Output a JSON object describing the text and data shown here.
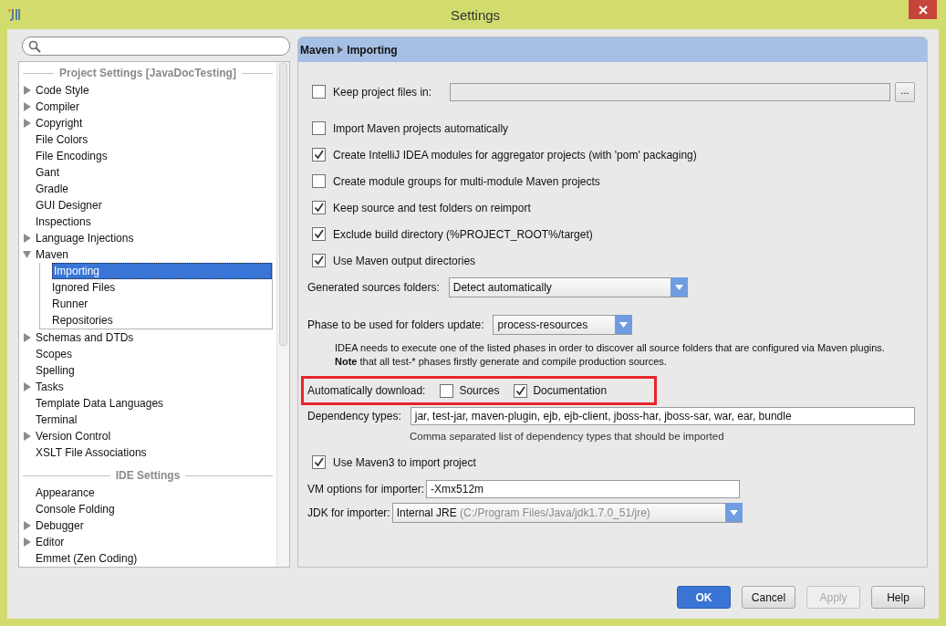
{
  "window": {
    "title": "Settings"
  },
  "sidebar": {
    "sections": [
      {
        "title": "Project Settings [JavaDocTesting]",
        "items": [
          {
            "label": "Code Style",
            "expandable": true,
            "expanded": false,
            "selected": false
          },
          {
            "label": "Compiler",
            "expandable": true,
            "expanded": false,
            "selected": false
          },
          {
            "label": "Copyright",
            "expandable": true,
            "expanded": false,
            "selected": false
          },
          {
            "label": "File Colors",
            "expandable": false,
            "selected": false
          },
          {
            "label": "File Encodings",
            "expandable": false,
            "selected": false
          },
          {
            "label": "Gant",
            "expandable": false,
            "selected": false
          },
          {
            "label": "Gradle",
            "expandable": false,
            "selected": false
          },
          {
            "label": "GUI Designer",
            "expandable": false,
            "selected": false
          },
          {
            "label": "Inspections",
            "expandable": false,
            "selected": false
          },
          {
            "label": "Language Injections",
            "expandable": true,
            "expanded": false,
            "selected": false
          },
          {
            "label": "Maven",
            "expandable": true,
            "expanded": true,
            "selected": false,
            "children": [
              {
                "label": "Importing",
                "selected": true
              },
              {
                "label": "Ignored Files",
                "selected": false
              },
              {
                "label": "Runner",
                "selected": false
              },
              {
                "label": "Repositories",
                "selected": false
              }
            ]
          },
          {
            "label": "Schemas and DTDs",
            "expandable": true,
            "expanded": false,
            "selected": false
          },
          {
            "label": "Scopes",
            "expandable": false,
            "selected": false
          },
          {
            "label": "Spelling",
            "expandable": false,
            "selected": false
          },
          {
            "label": "Tasks",
            "expandable": true,
            "expanded": false,
            "selected": false
          },
          {
            "label": "Template Data Languages",
            "expandable": false,
            "selected": false
          },
          {
            "label": "Terminal",
            "expandable": false,
            "selected": false
          },
          {
            "label": "Version Control",
            "expandable": true,
            "expanded": false,
            "selected": false
          },
          {
            "label": "XSLT File Associations",
            "expandable": false,
            "selected": false
          }
        ]
      },
      {
        "title": "IDE Settings",
        "items": [
          {
            "label": "Appearance",
            "expandable": false,
            "selected": false
          },
          {
            "label": "Console Folding",
            "expandable": false,
            "selected": false
          },
          {
            "label": "Debugger",
            "expandable": true,
            "expanded": false,
            "selected": false
          },
          {
            "label": "Editor",
            "expandable": true,
            "expanded": false,
            "selected": false
          },
          {
            "label": "Emmet (Zen Coding)",
            "expandable": false,
            "selected": false
          }
        ]
      }
    ]
  },
  "panel": {
    "breadcrumb": [
      "Maven",
      "Importing"
    ],
    "rows": [
      {
        "kind": "path",
        "label": "Keep project files in:",
        "checked": false,
        "button": "..."
      },
      {
        "kind": "checkbox",
        "label": "Import Maven projects automatically",
        "checked": false
      },
      {
        "kind": "checkbox",
        "label": "Create IntelliJ IDEA modules for aggregator projects (with 'pom' packaging)",
        "checked": true
      },
      {
        "kind": "checkbox",
        "label": "Create module groups for multi-module Maven projects",
        "checked": false
      },
      {
        "kind": "checkbox",
        "label": "Keep source and test folders on reimport",
        "checked": true
      },
      {
        "kind": "checkbox",
        "label": "Exclude build directory (%PROJECT_ROOT%/target)",
        "checked": true
      },
      {
        "kind": "checkbox",
        "label": "Use Maven output directories",
        "checked": true
      },
      {
        "kind": "select",
        "label": "Generated sources folders:",
        "value": "Detect automatically"
      },
      {
        "kind": "select",
        "label": "Phase to be used for folders update:",
        "value": "process-resources"
      },
      {
        "kind": "note",
        "lines": [
          "IDEA needs to execute one of the listed phases in order to discover all source folders that are configured via Maven plugins.",
          "**Note** that all test-* phases firstly generate and compile production sources."
        ]
      },
      {
        "kind": "options",
        "label": "Automatically download:",
        "highlighted": true,
        "options": [
          {
            "label": "Sources",
            "checked": false
          },
          {
            "label": "Documentation",
            "checked": true
          }
        ]
      },
      {
        "kind": "text",
        "label": "Dependency types:",
        "value": "jar, test-jar, maven-plugin, ejb, ejb-client, jboss-har, jboss-sar, war, ear, bundle",
        "hint": "Comma separated list of dependency types that should be imported"
      },
      {
        "kind": "checkbox",
        "label": "Use Maven3 to import project",
        "checked": true
      },
      {
        "kind": "text",
        "label": "VM options for importer:",
        "value": "-Xmx512m"
      },
      {
        "kind": "select",
        "label": "JDK for importer:",
        "value": "Internal JRE",
        "detail": "(C:/Program Files/Java/jdk1.7.0_51/jre)"
      }
    ]
  },
  "buttons": [
    {
      "label": "OK",
      "kind": "primary",
      "disabled": false
    },
    {
      "label": "Cancel",
      "kind": "normal",
      "disabled": false
    },
    {
      "label": "Apply",
      "kind": "normal",
      "disabled": true
    },
    {
      "label": "Help",
      "kind": "normal",
      "disabled": false
    }
  ]
}
